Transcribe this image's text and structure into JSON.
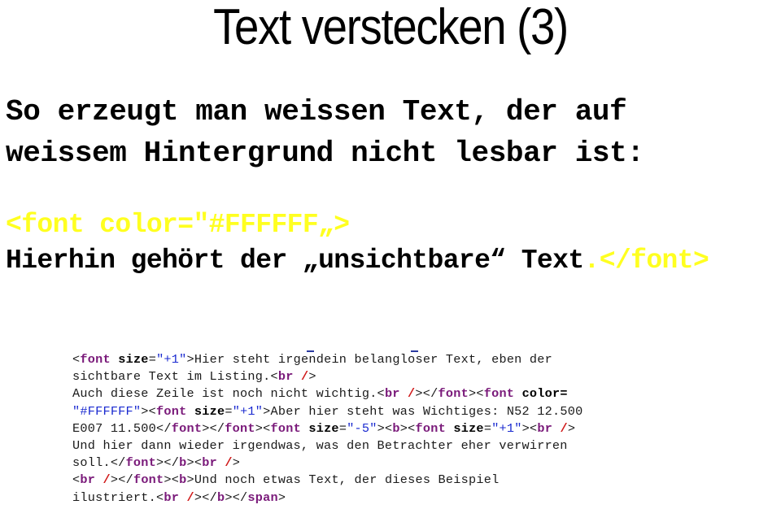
{
  "slide": {
    "title": "Text verstecken (3)",
    "intro_lines": [
      "So erzeugt man weissen Text, der auf",
      "weissem Hintergrund nicht lesbar ist:"
    ],
    "snippet": {
      "line1": "<font color=\"#FFFFFF„>",
      "line2_text": "Hierhin gehört der „unsichtbare“ Text",
      "line2_tail": ".</font>",
      "highlight_color": "#FFFF20"
    },
    "listing": {
      "colors": {
        "tag": "#7A1A7A",
        "value": "#1A2AD0",
        "slash": "#D01818",
        "text": "#1A1A1A"
      },
      "lines": [
        [
          {
            "t": "<",
            "k": "ang"
          },
          {
            "t": "font",
            "k": "tag"
          },
          {
            "t": " ",
            "k": "ang"
          },
          {
            "t": "size",
            "k": "attr"
          },
          {
            "t": "=",
            "k": "ang"
          },
          {
            "t": "\"+1\"",
            "k": "val"
          },
          {
            "t": ">Hier steht irgendein belangloser Text, eben der",
            "k": "ang"
          }
        ],
        [
          {
            "t": "sichtbare Text im Listing.<",
            "k": "ang"
          },
          {
            "t": "br",
            "k": "tag"
          },
          {
            "t": " ",
            "k": "ang"
          },
          {
            "t": "/",
            "k": "slash"
          },
          {
            "t": ">",
            "k": "ang"
          }
        ],
        [
          {
            "t": "Auch diese Zeile ist noch nicht wichtig.<",
            "k": "ang"
          },
          {
            "t": "br",
            "k": "tag"
          },
          {
            "t": " ",
            "k": "ang"
          },
          {
            "t": "/",
            "k": "slash"
          },
          {
            "t": "></",
            "k": "ang"
          },
          {
            "t": "font",
            "k": "tag"
          },
          {
            "t": "><",
            "k": "ang"
          },
          {
            "t": "font",
            "k": "tag"
          },
          {
            "t": " ",
            "k": "ang"
          },
          {
            "t": "color",
            "k": "attr"
          },
          {
            "t": "=",
            "k": "attr"
          }
        ],
        [
          {
            "t": "\"#FFFFFF\"",
            "k": "val"
          },
          {
            "t": "><",
            "k": "ang"
          },
          {
            "t": "font",
            "k": "tag"
          },
          {
            "t": " ",
            "k": "ang"
          },
          {
            "t": "size",
            "k": "attr"
          },
          {
            "t": "=",
            "k": "ang"
          },
          {
            "t": "\"+1\"",
            "k": "val"
          },
          {
            "t": ">Aber hier steht was Wichtiges: N52 12.500",
            "k": "ang"
          }
        ],
        [
          {
            "t": "E007 11.500</",
            "k": "ang"
          },
          {
            "t": "font",
            "k": "tag"
          },
          {
            "t": "></",
            "k": "ang"
          },
          {
            "t": "font",
            "k": "tag"
          },
          {
            "t": "><",
            "k": "ang"
          },
          {
            "t": "font",
            "k": "tag"
          },
          {
            "t": " ",
            "k": "ang"
          },
          {
            "t": "size",
            "k": "attr"
          },
          {
            "t": "=",
            "k": "ang"
          },
          {
            "t": "\"-5\"",
            "k": "val"
          },
          {
            "t": "><",
            "k": "ang"
          },
          {
            "t": "b",
            "k": "tag"
          },
          {
            "t": "><",
            "k": "ang"
          },
          {
            "t": "font",
            "k": "tag"
          },
          {
            "t": " ",
            "k": "ang"
          },
          {
            "t": "size",
            "k": "attr"
          },
          {
            "t": "=",
            "k": "ang"
          },
          {
            "t": "\"+1\"",
            "k": "val"
          },
          {
            "t": "><",
            "k": "ang"
          },
          {
            "t": "br",
            "k": "tag"
          },
          {
            "t": " ",
            "k": "ang"
          },
          {
            "t": "/",
            "k": "slash"
          },
          {
            "t": ">",
            "k": "ang"
          }
        ],
        [
          {
            "t": "Und hier dann wieder irgendwas, was den Betrachter eher verwirren",
            "k": "ang"
          }
        ],
        [
          {
            "t": "soll.</",
            "k": "ang"
          },
          {
            "t": "font",
            "k": "tag"
          },
          {
            "t": "></",
            "k": "ang"
          },
          {
            "t": "b",
            "k": "tag"
          },
          {
            "t": "><",
            "k": "ang"
          },
          {
            "t": "br",
            "k": "tag"
          },
          {
            "t": " ",
            "k": "ang"
          },
          {
            "t": "/",
            "k": "slash"
          },
          {
            "t": ">",
            "k": "ang"
          }
        ],
        [
          {
            "t": "<",
            "k": "ang"
          },
          {
            "t": "br",
            "k": "tag"
          },
          {
            "t": " ",
            "k": "ang"
          },
          {
            "t": "/",
            "k": "slash"
          },
          {
            "t": "></",
            "k": "ang"
          },
          {
            "t": "font",
            "k": "tag"
          },
          {
            "t": "><",
            "k": "ang"
          },
          {
            "t": "b",
            "k": "tag"
          },
          {
            "t": ">Und noch etwas Text, der dieses Beispiel",
            "k": "ang"
          }
        ],
        [
          {
            "t": "ilustriert.<",
            "k": "ang"
          },
          {
            "t": "br",
            "k": "tag"
          },
          {
            "t": " ",
            "k": "ang"
          },
          {
            "t": "/",
            "k": "slash"
          },
          {
            "t": "></",
            "k": "ang"
          },
          {
            "t": "b",
            "k": "tag"
          },
          {
            "t": "></",
            "k": "ang"
          },
          {
            "t": "span",
            "k": "tag"
          },
          {
            "t": ">",
            "k": "ang"
          }
        ]
      ]
    }
  }
}
